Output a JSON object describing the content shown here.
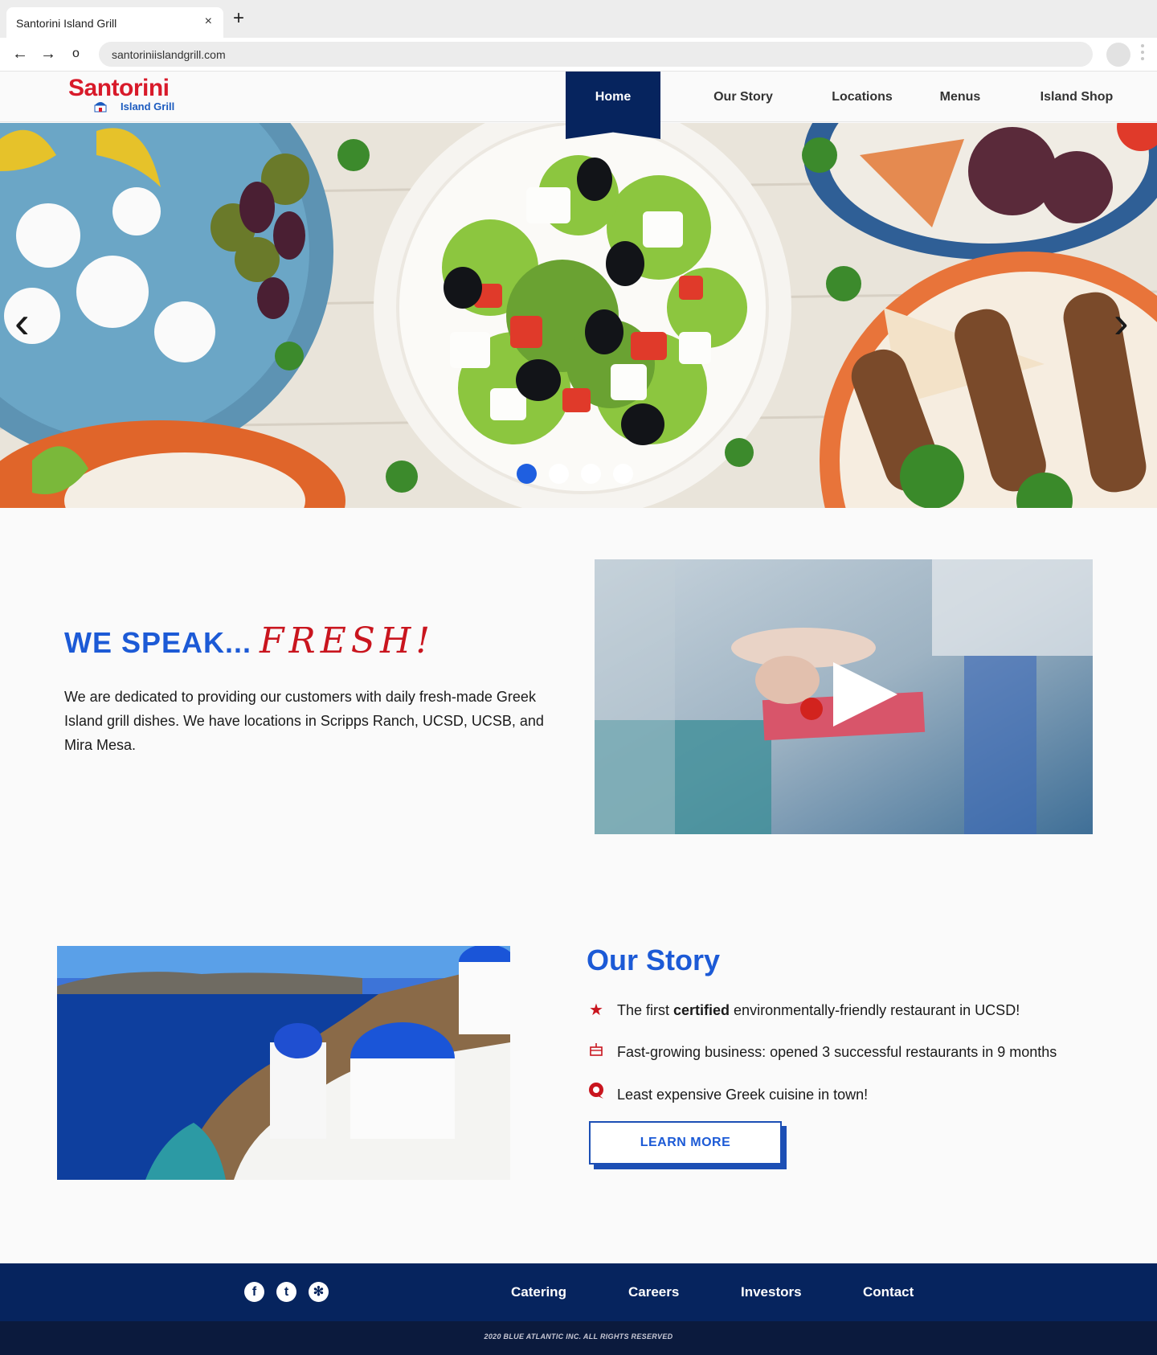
{
  "browser": {
    "tab_title": "Santorini Island Grill",
    "close_glyph": "×",
    "new_tab_glyph": "+",
    "url": "santoriniislandgrill.com",
    "back_glyph": "←",
    "forward_glyph": "→",
    "reload_glyph": "o"
  },
  "header": {
    "logo_main": "Santorini",
    "logo_sub": "Island Grill",
    "nav": [
      {
        "label": "Home",
        "active": true
      },
      {
        "label": "Our Story"
      },
      {
        "label": "Locations"
      },
      {
        "label": "Menus"
      },
      {
        "label": "Island Shop"
      }
    ]
  },
  "hero": {
    "prev_glyph": "‹",
    "next_glyph": "›",
    "slide_count": 4,
    "active_slide": 1
  },
  "fresh": {
    "heading_a": "WE SPEAK...",
    "heading_b": "FRESH!",
    "body": "We are dedicated to providing our customers with daily fresh-made Greek Island grill dishes. We have locations in Scripps Ranch, UCSD, UCSB, and Mira Mesa."
  },
  "story": {
    "heading": "Our Story",
    "bullets": [
      {
        "icon": "star-icon",
        "glyph": "★",
        "pre": "The first ",
        "bold": "certified",
        "post": " environmentally-friendly restaurant in UCSD!"
      },
      {
        "icon": "cake-icon",
        "glyph": "🎂",
        "pre": "Fast-growing business: opened  3 successful restaurants in 9 months",
        "bold": "",
        "post": ""
      },
      {
        "icon": "chat-icon",
        "glyph": "💬",
        "pre": "Least expensive Greek cuisine in town!",
        "bold": "",
        "post": ""
      }
    ],
    "button": "LEARN MORE"
  },
  "footer": {
    "social": [
      {
        "name": "facebook-icon",
        "glyph": "f"
      },
      {
        "name": "twitter-icon",
        "glyph": "t"
      },
      {
        "name": "yelp-icon",
        "glyph": "✻"
      }
    ],
    "links": [
      "Catering",
      "Careers",
      "Investors",
      "Contact"
    ],
    "copyright": "2020 BLUE ATLANTIC INC. ALL RIGHTS RESERVED"
  },
  "colors": {
    "brand_red": "#d81a2a",
    "brand_blue": "#1c5ad6",
    "navy": "#06245e"
  }
}
